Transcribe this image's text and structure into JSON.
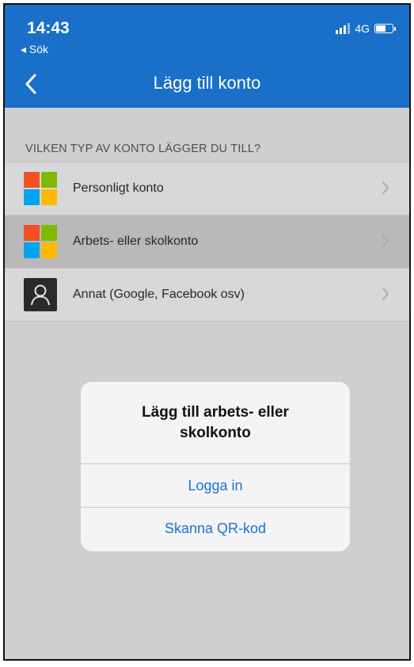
{
  "status_bar": {
    "time": "14:43",
    "back_app": "◂ Sök",
    "network": "4G"
  },
  "nav": {
    "title": "Lägg till konto",
    "back_icon": "chevron-left-icon"
  },
  "section": {
    "header": "VILKEN TYP AV KONTO LÄGGER DU TILL?"
  },
  "accounts": [
    {
      "label": "Personligt konto",
      "icon": "microsoft-logo-icon"
    },
    {
      "label": "Arbets- eller skolkonto",
      "icon": "microsoft-logo-icon"
    },
    {
      "label": "Annat (Google, Facebook osv)",
      "icon": "person-icon"
    }
  ],
  "alert": {
    "title": "Lägg till arbets- eller skolkonto",
    "buttons": [
      "Logga in",
      "Skanna QR-kod"
    ]
  },
  "colors": {
    "brand": "#1a6fc9",
    "link": "#1a73d1",
    "ms_red": "#f25022",
    "ms_green": "#7fba00",
    "ms_blue": "#00a4ef",
    "ms_yellow": "#ffb900"
  }
}
